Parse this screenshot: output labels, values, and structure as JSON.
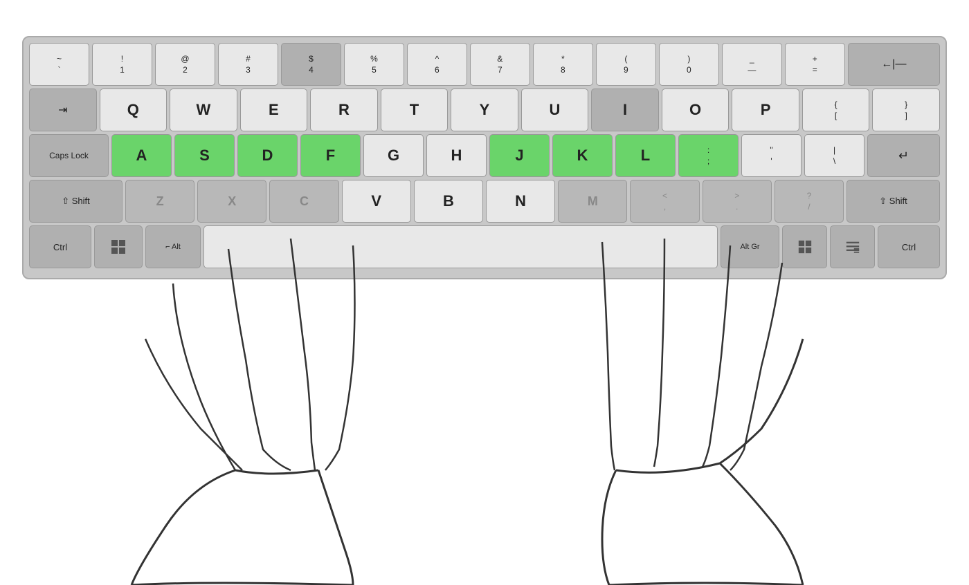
{
  "keyboard": {
    "row1": [
      {
        "top": "~",
        "bottom": "`",
        "style": ""
      },
      {
        "top": "!",
        "bottom": "1",
        "style": ""
      },
      {
        "top": "@",
        "bottom": "2",
        "style": ""
      },
      {
        "top": "#",
        "bottom": "3",
        "style": ""
      },
      {
        "top": "$",
        "bottom": "4",
        "style": "dark"
      },
      {
        "top": "%",
        "bottom": "5",
        "style": ""
      },
      {
        "top": "^",
        "bottom": "6",
        "style": ""
      },
      {
        "top": "&",
        "bottom": "7",
        "style": ""
      },
      {
        "top": "*",
        "bottom": "8",
        "style": ""
      },
      {
        "top": "(",
        "bottom": "9",
        "style": ""
      },
      {
        "top": ")",
        "bottom": "0",
        "style": ""
      },
      {
        "top": "_",
        "bottom": "—",
        "style": ""
      },
      {
        "top": "+",
        "bottom": "=",
        "style": ""
      },
      {
        "top": "backspace",
        "bottom": "←|—",
        "style": "dark"
      }
    ],
    "row2_letters": [
      "Q",
      "W",
      "E",
      "R",
      "T",
      "Y",
      "U",
      "I",
      "O",
      "P"
    ],
    "row3_letters": [
      {
        "char": "A",
        "style": "green"
      },
      {
        "char": "S",
        "style": "green"
      },
      {
        "char": "D",
        "style": "green"
      },
      {
        "char": "F",
        "style": "green"
      },
      {
        "char": "G",
        "style": ""
      },
      {
        "char": "H",
        "style": ""
      },
      {
        "char": "J",
        "style": "green"
      },
      {
        "char": "K",
        "style": "green"
      },
      {
        "char": "L",
        "style": "green"
      },
      {
        "char": ";",
        "style": "green",
        "top": ":"
      }
    ],
    "row4_letters": [
      {
        "char": "Z",
        "style": "gray"
      },
      {
        "char": "X",
        "style": "gray"
      },
      {
        "char": "C",
        "style": "gray"
      },
      {
        "char": "V",
        "style": ""
      },
      {
        "char": "B",
        "style": ""
      },
      {
        "char": "N",
        "style": ""
      },
      {
        "char": "M",
        "style": "gray"
      },
      {
        "char": ",",
        "style": "gray",
        "top": "<"
      },
      {
        "char": ".",
        "style": "gray",
        "top": ">"
      },
      {
        "char": "/",
        "style": "gray",
        "top": "?"
      }
    ],
    "labels": {
      "tab": "⇥",
      "caps": "Caps Lock",
      "enter": "↵",
      "shift_l": "⇧ Shift",
      "shift_r": "⇧ Shift",
      "ctrl": "Ctrl",
      "win": "⊞",
      "alt": "Alt",
      "altgr": "Alt Gr",
      "menu": "☰",
      "backspace": "←"
    }
  }
}
